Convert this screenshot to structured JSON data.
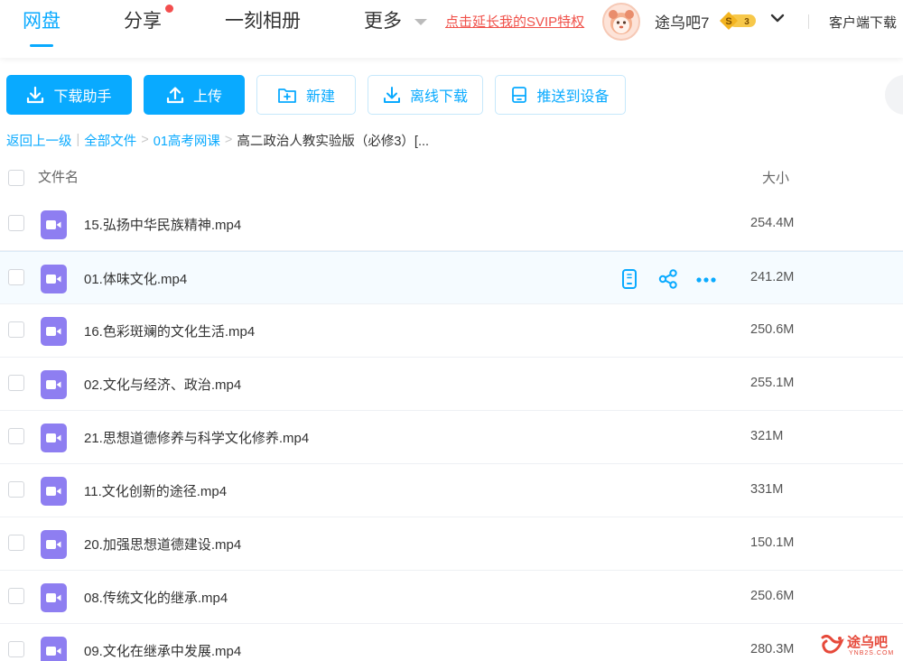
{
  "nav": {
    "tabs": [
      "网盘",
      "分享",
      "一刻相册",
      "更多"
    ],
    "active_tab": "网盘",
    "promo_link": "点击延长我的SVIP特权",
    "username": "途乌吧7",
    "vip_badge_letter": "S",
    "vip_level": "3",
    "client_download": "客户端下载",
    "accent_color": "#09AAFF"
  },
  "toolbar": {
    "download_helper": "下载助手",
    "upload": "上传",
    "new_folder": "新建",
    "offline_download": "离线下载",
    "push_to_device": "推送到设备"
  },
  "breadcrumb": {
    "back": "返回上一级",
    "all_files": "全部文件",
    "folder": "01高考网课",
    "current": "高二政治人教实验版（必修3）[..."
  },
  "list": {
    "header_name": "文件名",
    "header_size": "大小",
    "files": [
      {
        "name": "15.弘扬中华民族精神.mp4",
        "size": "254.4M"
      },
      {
        "name": "01.体味文化.mp4",
        "size": "241.2M"
      },
      {
        "name": "16.色彩斑斓的文化生活.mp4",
        "size": "250.6M"
      },
      {
        "name": "02.文化与经济、政治.mp4",
        "size": "255.1M"
      },
      {
        "name": "21.思想道德修养与科学文化修养.mp4",
        "size": "321M"
      },
      {
        "name": "11.文化创新的途径.mp4",
        "size": "331M"
      },
      {
        "name": "20.加强思想道德建设.mp4",
        "size": "150.1M"
      },
      {
        "name": "08.传统文化的继承.mp4",
        "size": "250.6M"
      },
      {
        "name": "09.文化在继承中发展.mp4",
        "size": "280.3M"
      }
    ],
    "hovered_row": 1,
    "row_action_icons": [
      "phone-push-icon",
      "share-icon",
      "more-icon"
    ],
    "file_icon": "video-file-icon",
    "file_icon_color": "#8e7ef1"
  },
  "watermark": {
    "text": "途乌吧",
    "subtext": "YNB2S.COM"
  }
}
